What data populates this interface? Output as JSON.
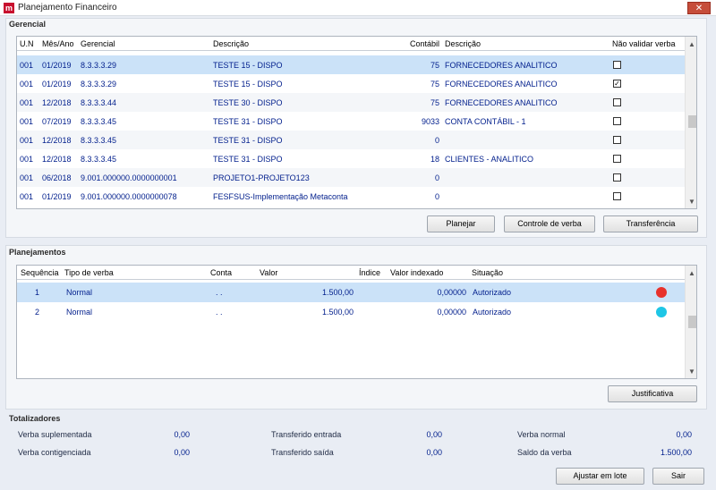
{
  "window": {
    "title": "Planejamento Financeiro",
    "close_glyph": "✕",
    "app_icon_glyph": "m"
  },
  "gerencial": {
    "label": "Gerencial",
    "columns": [
      "U.N",
      "Mês/Ano",
      "Gerencial",
      "Descrição",
      "Contábil",
      "Descrição",
      "Não validar verba"
    ],
    "rows": [
      {
        "un": "001",
        "mes": "01/2019",
        "gerencial": "8.3.3.3.29",
        "descricao": "TESTE 15 - DISPO",
        "contabil": "75",
        "descricao2": "FORNECEDORES ANALITICO",
        "nao_validar": false
      },
      {
        "un": "001",
        "mes": "01/2019",
        "gerencial": "8.3.3.3.29",
        "descricao": "TESTE 15 - DISPO",
        "contabil": "75",
        "descricao2": "FORNECEDORES ANALITICO",
        "nao_validar": true
      },
      {
        "un": "001",
        "mes": "12/2018",
        "gerencial": "8.3.3.3.44",
        "descricao": "TESTE 30 - DISPO",
        "contabil": "75",
        "descricao2": "FORNECEDORES ANALITICO",
        "nao_validar": false
      },
      {
        "un": "001",
        "mes": "07/2019",
        "gerencial": "8.3.3.3.45",
        "descricao": "TESTE 31 - DISPO",
        "contabil": "9033",
        "descricao2": "CONTA CONTÁBIL - 1",
        "nao_validar": false
      },
      {
        "un": "001",
        "mes": "12/2018",
        "gerencial": "8.3.3.3.45",
        "descricao": "TESTE 31 - DISPO",
        "contabil": "0",
        "descricao2": "",
        "nao_validar": false
      },
      {
        "un": "001",
        "mes": "12/2018",
        "gerencial": "8.3.3.3.45",
        "descricao": "TESTE 31 - DISPO",
        "contabil": "18",
        "descricao2": "CLIENTES - ANALITICO",
        "nao_validar": false
      },
      {
        "un": "001",
        "mes": "06/2018",
        "gerencial": "9.001.000000.0000000001",
        "descricao": "PROJETO1-PROJETO123",
        "contabil": "0",
        "descricao2": "",
        "nao_validar": false
      },
      {
        "un": "001",
        "mes": "01/2019",
        "gerencial": "9.001.000000.0000000078",
        "descricao": "FESFSUS-Implementação Metaconta",
        "contabil": "0",
        "descricao2": "",
        "nao_validar": false
      }
    ],
    "buttons": {
      "planejar": "Planejar",
      "controle": "Controle de verba",
      "transferencia": "Transferência"
    }
  },
  "planejamentos": {
    "label": "Planejamentos",
    "columns": [
      "Sequência",
      "Tipo de verba",
      "Conta",
      "Valor",
      "Índice",
      "Valor indexado",
      "Situação"
    ],
    "rows": [
      {
        "seq": "1",
        "tipo": "Normal",
        "conta": ". .",
        "valor": "1.500,00",
        "indice": "",
        "valor_indexado": "0,00000",
        "situacao": "Autorizado",
        "status_color": "#e8322c"
      },
      {
        "seq": "2",
        "tipo": "Normal",
        "conta": ". .",
        "valor": "1.500,00",
        "indice": "",
        "valor_indexado": "0,00000",
        "situacao": "Autorizado",
        "status_color": "#1ec6e6"
      }
    ],
    "buttons": {
      "justificativa": "Justificativa"
    }
  },
  "totalizadores": {
    "label": "Totalizadores",
    "verba_suplementada": {
      "label": "Verba suplementada",
      "value": "0,00"
    },
    "verba_contingenciada": {
      "label": "Verba contigenciada",
      "value": "0,00"
    },
    "transferido_entrada": {
      "label": "Transferido entrada",
      "value": "0,00"
    },
    "transferido_saida": {
      "label": "Transferido saída",
      "value": "0,00"
    },
    "verba_normal": {
      "label": "Verba normal",
      "value": "0,00"
    },
    "saldo_verba": {
      "label": "Saldo da verba",
      "value": "1.500,00"
    }
  },
  "footer": {
    "ajustar": "Ajustar em lote",
    "sair": "Sair"
  },
  "colors": {
    "selection": "#cbe2f8",
    "text_value": "#001e8c"
  }
}
